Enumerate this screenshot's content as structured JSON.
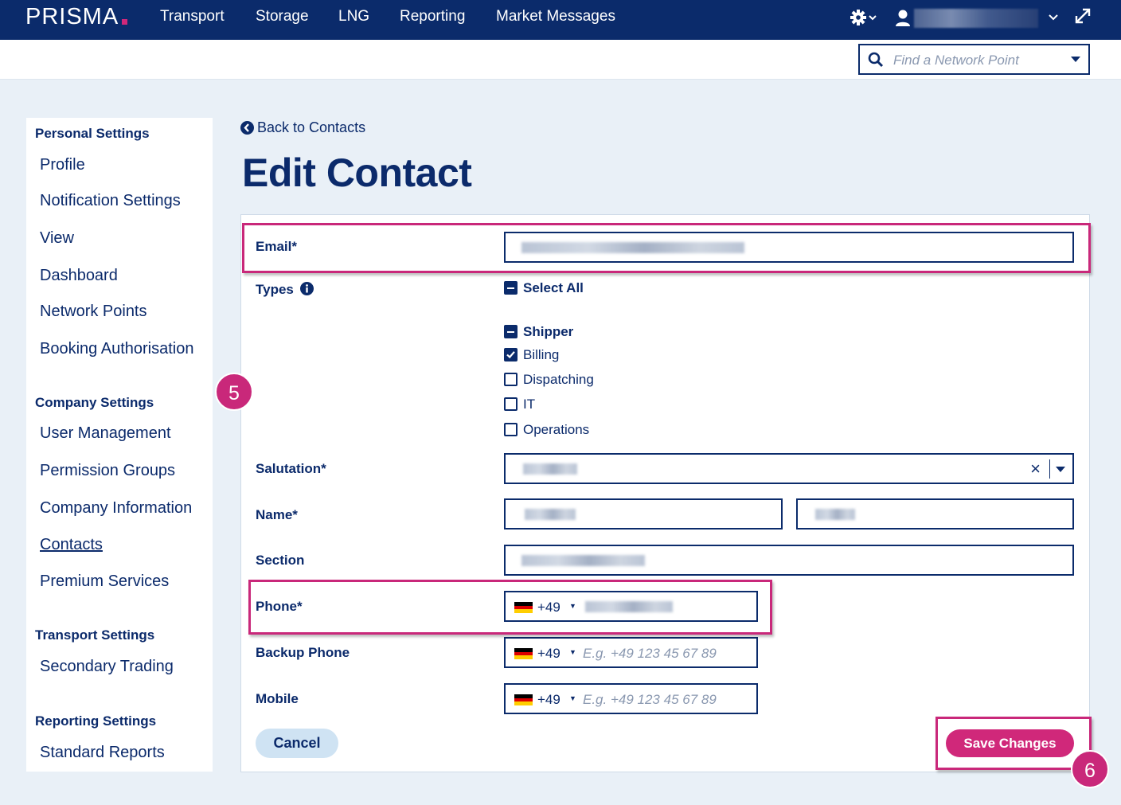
{
  "app": {
    "logo": "PRISMA"
  },
  "nav": {
    "items": [
      "Transport",
      "Storage",
      "LNG",
      "Reporting",
      "Market Messages"
    ]
  },
  "search": {
    "placeholder": "Find a Network Point"
  },
  "sidebar": {
    "personal": {
      "heading": "Personal Settings",
      "items": [
        "Profile",
        "Notification Settings",
        "View",
        "Dashboard",
        "Network Points",
        "Booking Authorisation"
      ]
    },
    "company": {
      "heading": "Company Settings",
      "items": [
        "User Management",
        "Permission Groups",
        "Company Information",
        "Contacts",
        "Premium Services"
      ]
    },
    "transport": {
      "heading": "Transport Settings",
      "items": [
        "Secondary Trading"
      ]
    },
    "reporting": {
      "heading": "Reporting Settings",
      "items": [
        "Standard Reports"
      ]
    }
  },
  "page": {
    "back_label": "Back to Contacts",
    "title": "Edit Contact"
  },
  "form": {
    "email_label": "Email*",
    "types_label": "Types",
    "select_all": "Select All",
    "types": [
      {
        "label": "Shipper",
        "state": "indeterminate"
      },
      {
        "label": "Billing",
        "state": "checked"
      },
      {
        "label": "Dispatching",
        "state": "unchecked"
      },
      {
        "label": "IT",
        "state": "unchecked"
      },
      {
        "label": "Operations",
        "state": "unchecked"
      }
    ],
    "salutation_label": "Salutation*",
    "clear_symbol": "×",
    "name_label": "Name*",
    "section_label": "Section",
    "phone_label": "Phone*",
    "backup_phone_label": "Backup Phone",
    "mobile_label": "Mobile",
    "country_code": "+49",
    "phone_placeholder": "E.g. +49 123 45 67 89",
    "cancel_label": "Cancel",
    "save_label": "Save Changes"
  },
  "annotations": {
    "step5": "5",
    "step6": "6"
  },
  "colors": {
    "navy": "#0b2b6b",
    "accent": "#d0287a",
    "highlight": "#c9287a",
    "cancel_bg": "#cfe3f3"
  }
}
